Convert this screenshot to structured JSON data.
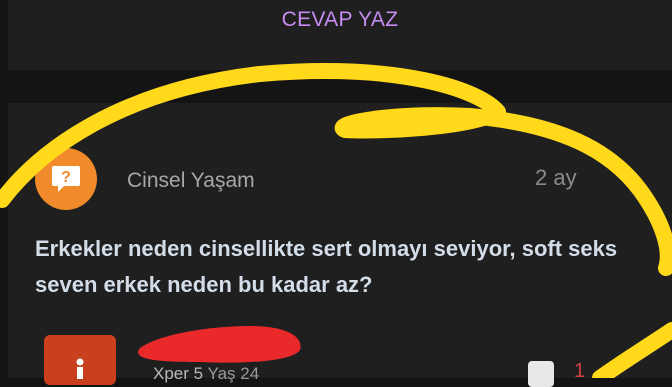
{
  "top": {
    "answer_button": "CEVAP YAZ"
  },
  "post": {
    "category": "Cinsel Yaşam",
    "category_icon": "question-bubble-icon",
    "time": "2 ay",
    "question": "Erkekler neden cinsellikte sert olmayı seviyor, soft seks seven erkek neden bu kadar az?"
  },
  "answer": {
    "level": "Xper 5",
    "age": "Yaş 24",
    "like_count": "1"
  },
  "colors": {
    "accent": "#c68cf2",
    "category_badge": "#f08a2b",
    "scribble_yellow": "#ffd91a",
    "redaction_red": "#ea2a2a"
  }
}
